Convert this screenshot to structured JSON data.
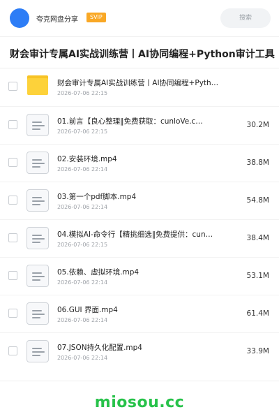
{
  "header": {
    "username": "夸克网盘分享",
    "badge": "SVIP",
    "search_placeholder": "搜索"
  },
  "share_title": "财会审计专属AI实战训练营丨AI协同编程+Python审计工具",
  "files": [
    {
      "name": "财会审计专属AI实战训练营丨AI协同编程+Pyth…",
      "date": "2026-07-06 22:15",
      "size": "",
      "icon": "folder-icon"
    },
    {
      "name": "01.前言【良心整理‖免费获取：cunloVe.c…",
      "date": "2026-07-06 22:15",
      "size": "30.2M",
      "icon": "document-icon"
    },
    {
      "name": "02.安装环境.mp4",
      "date": "2026-07-06 22:14",
      "size": "38.8M",
      "icon": "document-icon"
    },
    {
      "name": "03.第一个pdf脚本.mp4",
      "date": "2026-07-06 22:14",
      "size": "54.8M",
      "icon": "document-icon"
    },
    {
      "name": "04.模拟AI-命令行【精挑细选‖免费提供：cun…",
      "date": "2026-07-06 22:15",
      "size": "38.4M",
      "icon": "document-icon"
    },
    {
      "name": "05.依赖、虚拟环境.mp4",
      "date": "2026-07-06 22:14",
      "size": "53.1M",
      "icon": "document-icon"
    },
    {
      "name": "06.GUI 界面.mp4",
      "date": "2026-07-06 22:14",
      "size": "61.4M",
      "icon": "document-icon"
    },
    {
      "name": "07.JSON持久化配置.mp4",
      "date": "2026-07-06 22:14",
      "size": "33.9M",
      "icon": "document-icon"
    }
  ],
  "watermark": "miosou.cc",
  "colors": {
    "accent": "#2d7df6",
    "badge": "#f9a825",
    "watermark": "#27c24a",
    "folder": "#fdd23a"
  }
}
